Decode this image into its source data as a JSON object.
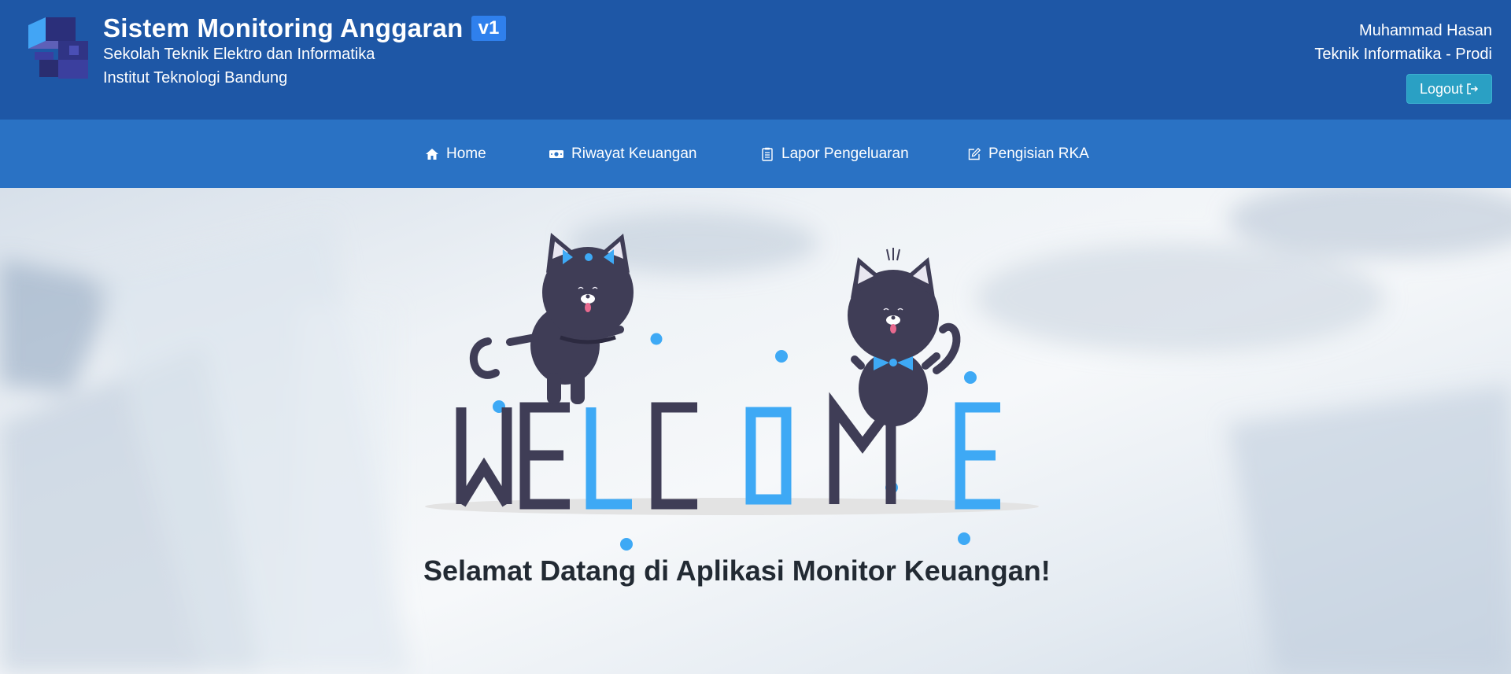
{
  "header": {
    "app_title": "Sistem Monitoring Anggaran",
    "version": "v1",
    "faculty": "Sekolah Teknik Elektro dan Informatika",
    "institute": "Institut Teknologi Bandung",
    "user_name": "Muhammad Hasan",
    "user_role": "Teknik Informatika - Prodi",
    "logout_label": "Logout"
  },
  "nav": {
    "items": [
      {
        "label": "Home",
        "icon": "home-icon"
      },
      {
        "label": "Riwayat Keuangan",
        "icon": "money-icon"
      },
      {
        "label": "Lapor Pengeluaran",
        "icon": "clipboard-icon"
      },
      {
        "label": "Pengisian RKA",
        "icon": "edit-icon"
      }
    ]
  },
  "hero": {
    "art_text": "WELCOME",
    "welcome_message": "Selamat Datang di Aplikasi Monitor Keuangan!"
  },
  "colors": {
    "header_bg": "#1e57a6",
    "navbar_bg": "#2a72c4",
    "accent_blue": "#3ea9f5",
    "dark_letter": "#3f3d56",
    "logout_bg": "#2aa0c4"
  }
}
